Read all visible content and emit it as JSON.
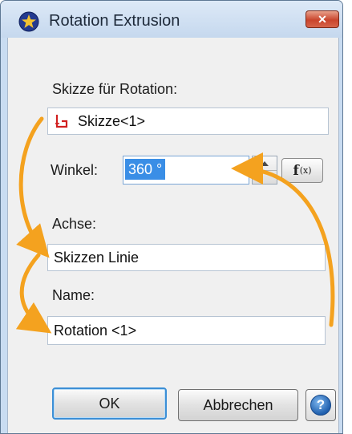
{
  "window": {
    "title": "Rotation Extrusion",
    "close_label": "✕"
  },
  "form": {
    "sketch_label": "Skizze für Rotation:",
    "sketch_value": "Skizze<1>",
    "angle_label": "Winkel:",
    "angle_value": "360 °",
    "axis_label": "Achse:",
    "axis_value": "Skizzen Linie",
    "name_label": "Name:",
    "name_value": "Rotation <1>"
  },
  "buttons": {
    "ok": "OK",
    "cancel": "Abbrechen",
    "formula_main": "f",
    "formula_sub": "(x)",
    "help": "?"
  },
  "colors": {
    "annotation_arrow": "#f4a21f",
    "selection": "#3a8ee6",
    "sketch_icon": "#d11f1f"
  },
  "icons": {
    "app": "rotation-extrusion-icon",
    "sketch": "sketch-icon",
    "help": "help-icon"
  }
}
